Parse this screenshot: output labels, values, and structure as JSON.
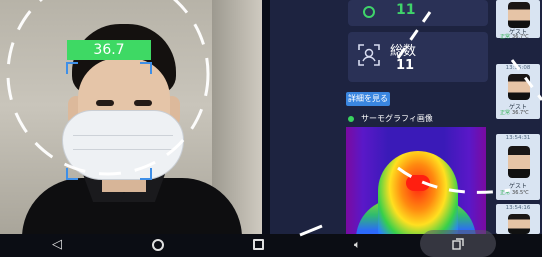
{
  "camera": {
    "temperature": "36.7"
  },
  "stats": {
    "passed_count": "11",
    "total_label": "総数",
    "total_count": "11",
    "details_button": "詳細を見る"
  },
  "thermal": {
    "title": "サーモグラフィ画像"
  },
  "history": [
    {
      "time": "",
      "name": "ゲスト",
      "status": "正常",
      "temp": "36.7℃"
    },
    {
      "time": "13:55:08",
      "name": "ゲスト",
      "status": "正常",
      "temp": "36.7℃"
    },
    {
      "time": "13:54:31",
      "name": "ゲスト",
      "status": "正常",
      "temp": "36.5℃"
    },
    {
      "time": "13:54:16",
      "name": "",
      "status": "",
      "temp": ""
    }
  ],
  "navbar": {
    "back_icon": "back-icon",
    "home_icon": "home-icon",
    "recent_icon": "recent-apps-icon",
    "volume_icon": "volume-icon",
    "screenshot_icon": "screenshot-icon"
  },
  "colors": {
    "accent_green": "#3ed964",
    "accent_blue": "#3a86e0",
    "panel_bg": "#1d2340"
  }
}
